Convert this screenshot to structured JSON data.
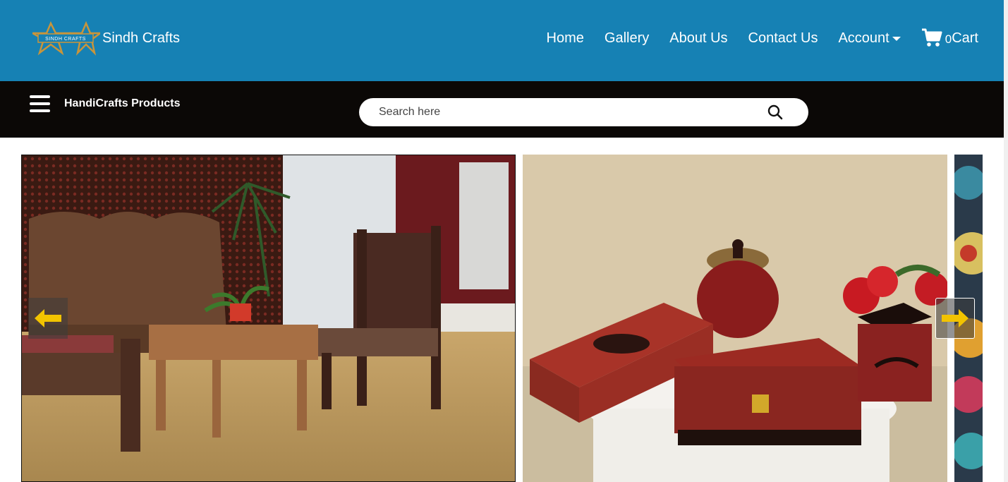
{
  "header": {
    "logo_text": "SINDH CRAFTS",
    "brand": "Sindh Crafts",
    "nav": {
      "home": "Home",
      "gallery": "Gallery",
      "about": "About Us",
      "contact": "Contact Us",
      "account": "Account",
      "cart_count": "0",
      "cart_label": "Cart"
    }
  },
  "subbar": {
    "menu_icon": "hamburger-icon",
    "products_label": "HandiCrafts Products",
    "search": {
      "placeholder": "Search here",
      "value": "",
      "icon": "search-icon"
    }
  },
  "carousel": {
    "prev_icon": "arrow-left-icon",
    "next_icon": "arrow-right-icon",
    "arrow_color": "#f2c300"
  },
  "colors": {
    "header_bg": "#1681b4",
    "subbar_bg": "#0b0806",
    "logo_gold": "#c8953b"
  }
}
